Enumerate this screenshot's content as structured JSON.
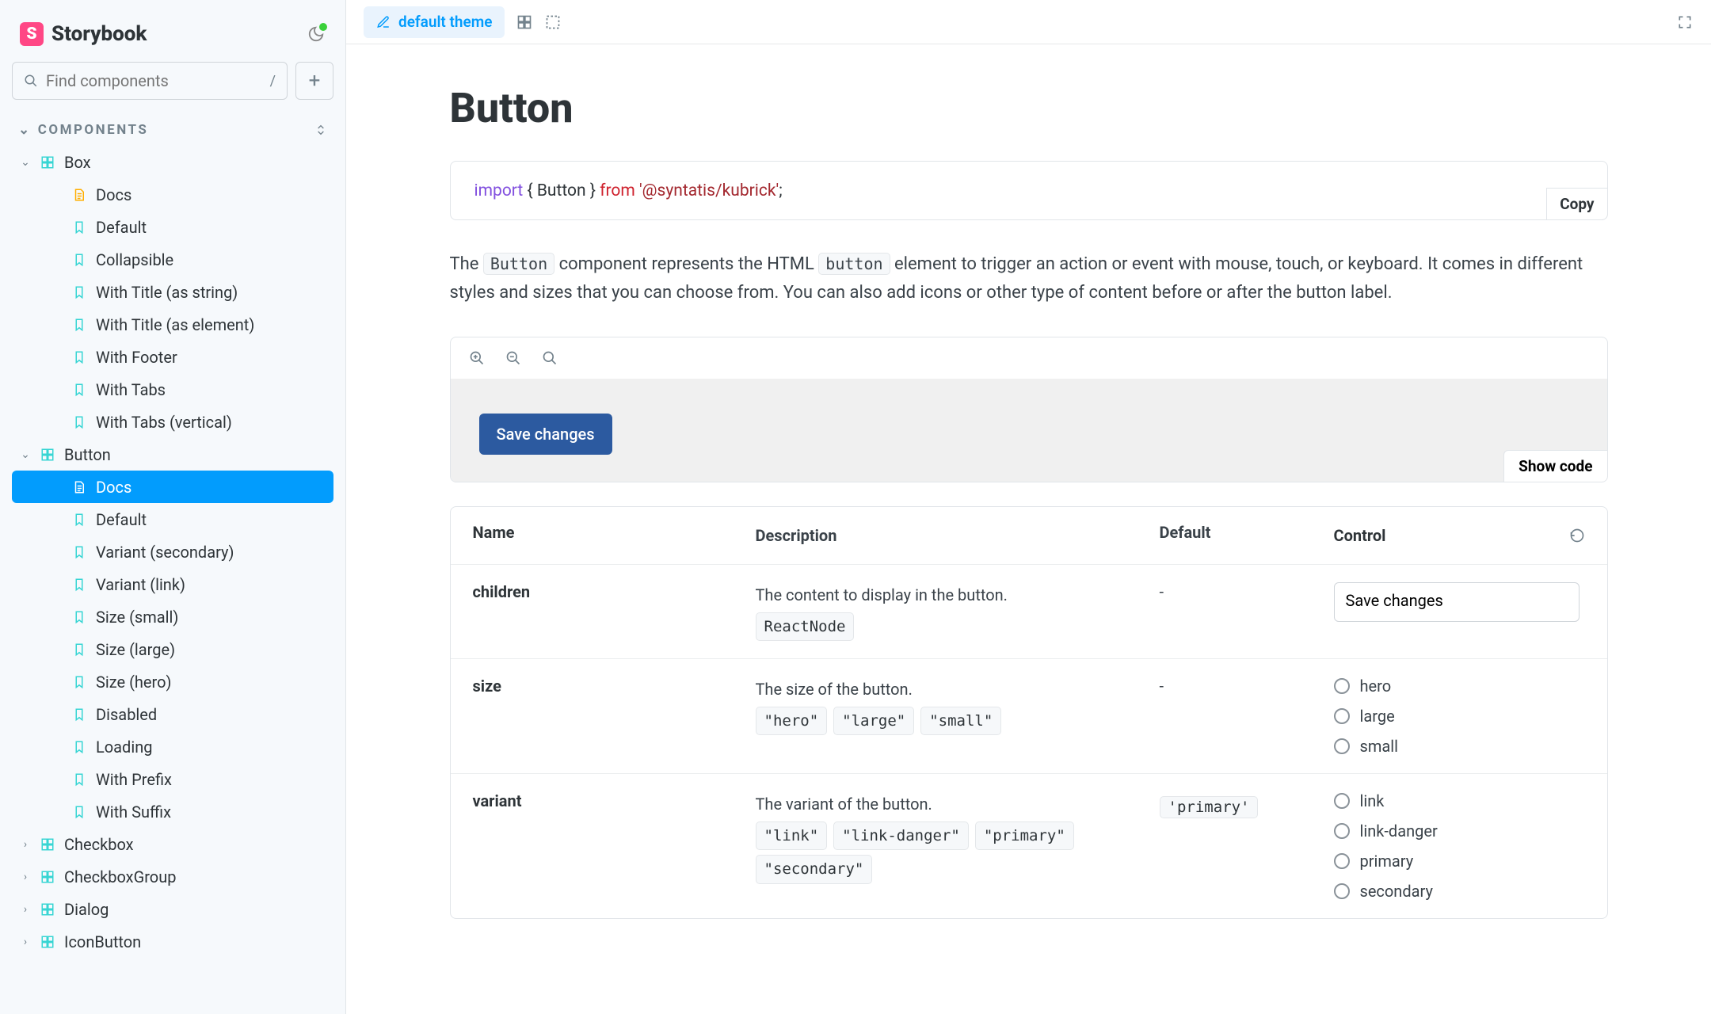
{
  "brand": "Storybook",
  "search": {
    "placeholder": "Find components",
    "kbd": "/"
  },
  "section_label": "COMPONENTS",
  "tree": {
    "box": {
      "label": "Box",
      "children": [
        "Docs",
        "Default",
        "Collapsible",
        "With Title (as string)",
        "With Title (as element)",
        "With Footer",
        "With Tabs",
        "With Tabs (vertical)"
      ]
    },
    "button": {
      "label": "Button",
      "children": [
        "Docs",
        "Default",
        "Variant (secondary)",
        "Variant (link)",
        "Size (small)",
        "Size (large)",
        "Size (hero)",
        "Disabled",
        "Loading",
        "With Prefix",
        "With Suffix"
      ]
    },
    "rest": [
      "Checkbox",
      "CheckboxGroup",
      "Dialog",
      "IconButton"
    ]
  },
  "topbar": {
    "theme_label": "default theme"
  },
  "doc": {
    "title": "Button",
    "code": {
      "import_kw": "import",
      "braces_open": " { ",
      "symbol": "Button",
      "braces_close": " } ",
      "from_kw": "from",
      "pkg": "'@syntatis/kubrick'",
      "semi": ";",
      "copy": "Copy"
    },
    "para_pre": "The ",
    "para_mid1": " component represents the HTML ",
    "para_mid2": " element to trigger an action or event with mouse, touch, or keyboard. It comes in different styles and sizes that you can choose from. You can also add icons or other type of content before or after the button label.",
    "code_inline1": "Button",
    "code_inline2": "button",
    "example_button": "Save changes",
    "show_code": "Show code",
    "args": {
      "headers": {
        "name": "Name",
        "desc": "Description",
        "def": "Default",
        "ctrl": "Control"
      },
      "rows": [
        {
          "name": "children",
          "desc": "The content to display in the button.",
          "type_tags": [
            "ReactNode"
          ],
          "default": "-",
          "control": {
            "kind": "text",
            "value": "Save changes"
          }
        },
        {
          "name": "size",
          "desc": "The size of the button.",
          "type_tags": [
            "\"hero\"",
            "\"large\"",
            "\"small\""
          ],
          "default": "-",
          "control": {
            "kind": "radio",
            "options": [
              "hero",
              "large",
              "small"
            ]
          }
        },
        {
          "name": "variant",
          "desc": "The variant of the button.",
          "type_tags": [
            "\"link\"",
            "\"link-danger\"",
            "\"primary\"",
            "\"secondary\""
          ],
          "default": "'primary'",
          "control": {
            "kind": "radio",
            "options": [
              "link",
              "link-danger",
              "primary",
              "secondary"
            ]
          }
        }
      ]
    }
  }
}
